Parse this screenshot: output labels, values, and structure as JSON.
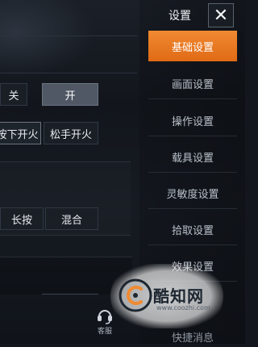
{
  "header": {
    "title": "设置",
    "close_glyph": "✕"
  },
  "controls": {
    "toggle_off": "关",
    "toggle_on": "开",
    "fire_press": "按下开火",
    "fire_release": "松手开火",
    "hold": "长按",
    "mixed": "混合"
  },
  "menu": {
    "items": [
      {
        "label": "基础设置",
        "active": true
      },
      {
        "label": "画面设置",
        "active": false
      },
      {
        "label": "操作设置",
        "active": false
      },
      {
        "label": "载具设置",
        "active": false
      },
      {
        "label": "灵敏度设置",
        "active": false
      },
      {
        "label": "拾取设置",
        "active": false
      },
      {
        "label": "效果设置",
        "active": false
      },
      {
        "label": "快捷消息",
        "active": false
      }
    ]
  },
  "service": {
    "label": "客服",
    "icon": "headset-icon"
  },
  "watermark": {
    "name": "酷知网",
    "url": "www.coozhi.com"
  },
  "colors": {
    "accent": "#e8781f",
    "panel": "#1e242c",
    "active_button": "#4f5864"
  }
}
